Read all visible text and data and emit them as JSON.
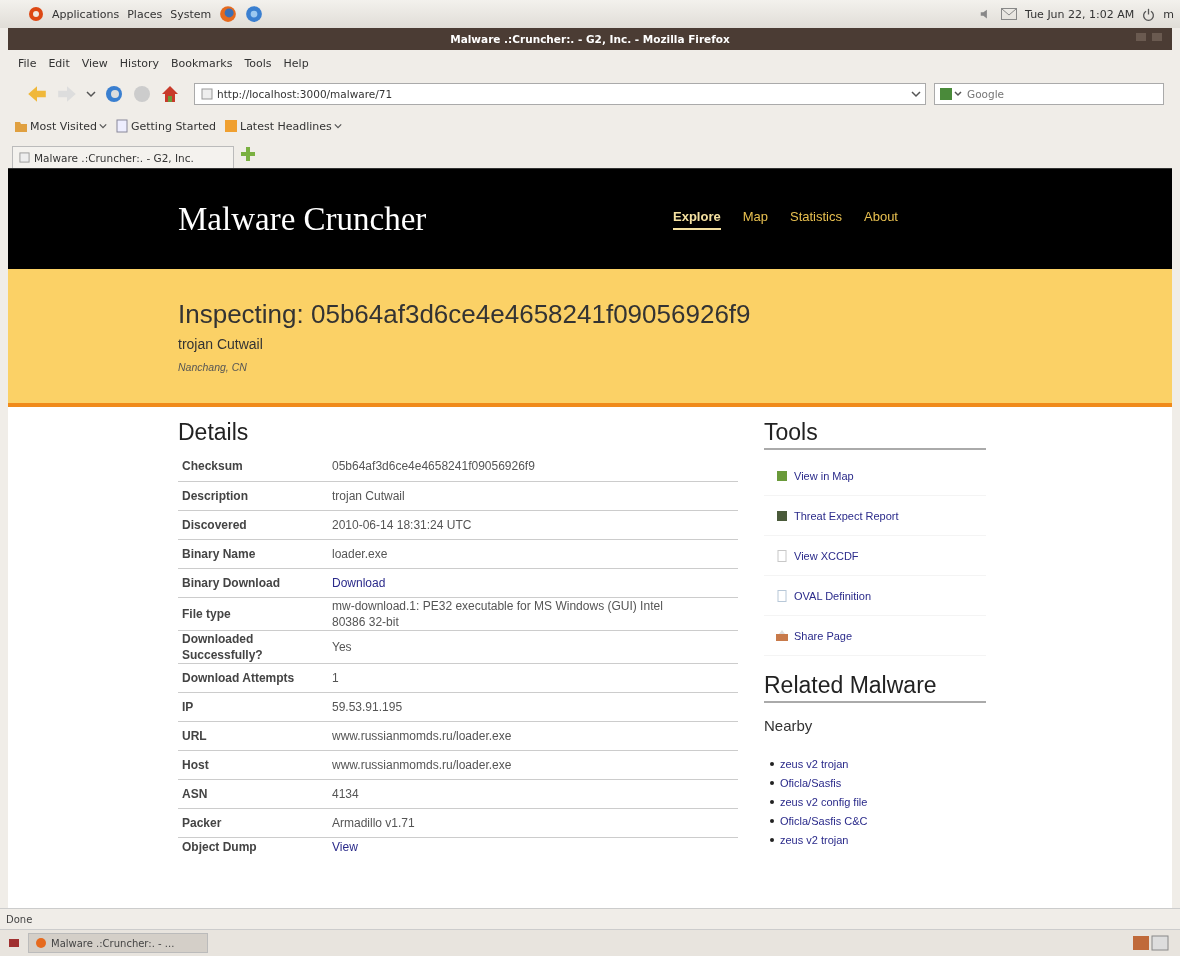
{
  "top_panel": {
    "menus": [
      "Applications",
      "Places",
      "System"
    ],
    "clock": "Tue Jun 22,  1:02 AM",
    "user": "m"
  },
  "window": {
    "title": "Malware .:Cruncher:. - G2, Inc. - Mozilla Firefox"
  },
  "menu_bar": [
    "File",
    "Edit",
    "View",
    "History",
    "Bookmarks",
    "Tools",
    "Help"
  ],
  "address_bar": {
    "value": "http://localhost:3000/malware/71"
  },
  "search": {
    "placeholder": "Google"
  },
  "bookmarks": [
    {
      "label": "Most Visited",
      "dropdown": true
    },
    {
      "label": "Getting Started",
      "dropdown": false
    },
    {
      "label": "Latest Headlines",
      "dropdown": true
    }
  ],
  "tabs": [
    {
      "label": "Malware .:Cruncher:. - G2, Inc.",
      "selected": true
    }
  ],
  "site": {
    "title": "Malware Cruncher",
    "nav": [
      {
        "label": "Explore",
        "selected": true
      },
      {
        "label": "Map",
        "selected": false
      },
      {
        "label": "Statistics",
        "selected": false
      },
      {
        "label": "About",
        "selected": false
      }
    ]
  },
  "banner": {
    "heading": "Inspecting: 05b64af3d6ce4e4658241f09056926f9",
    "subtitle": "trojan Cutwail",
    "location": "Nanchang, CN"
  },
  "details": {
    "heading": "Details",
    "rows": [
      {
        "label": "Checksum",
        "value": "05b64af3d6ce4e4658241f09056926f9",
        "kind": "text"
      },
      {
        "label": "Description",
        "value": "trojan Cutwail",
        "kind": "text"
      },
      {
        "label": "Discovered",
        "value": "2010-06-14 18:31:24 UTC",
        "kind": "text"
      },
      {
        "label": "Binary Name",
        "value": "loader.exe",
        "kind": "text"
      },
      {
        "label": "Binary Download",
        "value": "Download",
        "kind": "link"
      },
      {
        "label": "File type",
        "value": "mw-download.1: PE32 executable for MS Windows (GUI) Intel 80386 32-bit",
        "kind": "text"
      },
      {
        "label": "Downloaded Successfully?",
        "value": "Yes",
        "kind": "text"
      },
      {
        "label": "Download Attempts",
        "value": "1",
        "kind": "text"
      },
      {
        "label": "IP",
        "value": "59.53.91.195",
        "kind": "text"
      },
      {
        "label": "URL",
        "value": "www.russianmomds.ru/loader.exe",
        "kind": "text"
      },
      {
        "label": "Host",
        "value": "www.russianmomds.ru/loader.exe",
        "kind": "text"
      },
      {
        "label": "ASN",
        "value": "4134",
        "kind": "text"
      },
      {
        "label": "Packer",
        "value": "Armadillo v1.71",
        "kind": "text"
      },
      {
        "label": "Object Dump",
        "value": "View",
        "kind": "link"
      }
    ]
  },
  "tools": {
    "heading": "Tools",
    "items": [
      {
        "label": "View in Map",
        "kind": "map"
      },
      {
        "label": "Threat Expect Report",
        "kind": "report"
      },
      {
        "label": "View XCCDF",
        "kind": "doc"
      },
      {
        "label": "OVAL Definition",
        "kind": "page"
      },
      {
        "label": "Share Page",
        "kind": "share"
      }
    ]
  },
  "related": {
    "heading": "Related Malware",
    "subheading": "Nearby",
    "items": [
      "zeus v2 trojan",
      "Oficla/Sasfis",
      "zeus v2 config file",
      "Oficla/Sasfis C&C",
      "zeus v2 trojan"
    ]
  },
  "status_bar": {
    "text": "Done"
  },
  "taskbar": {
    "items": [
      {
        "label": "Malware .:Cruncher:. - ...",
        "selected": true
      }
    ]
  }
}
